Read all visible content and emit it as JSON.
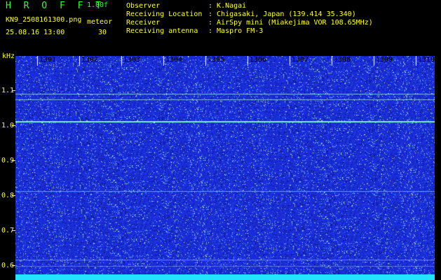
{
  "header": {
    "title": "H R O F F T",
    "version": "1.00f",
    "filename": "KN9_2508161300.png",
    "meteor_label": "meteor",
    "datetime": "25.08.16 13:00",
    "meteor_count": "30",
    "info": [
      {
        "label": "Observer",
        "value": ": K.Nagai"
      },
      {
        "label": "Receiving Location",
        "value": ": Chigasaki, Japan (139.414 35.340)"
      },
      {
        "label": "Receiver",
        "value": ": AirSpy mini (Miakejima VOR 108.65MHz)"
      },
      {
        "label": "Receiving antenna",
        "value": ": Maspro FM-3"
      }
    ]
  },
  "spectrogram": {
    "y_unit": "kHz",
    "y_ticks": [
      "1.1",
      "1.0",
      "0.9",
      "0.8",
      "0.7",
      "0.6"
    ],
    "x_ticks": [
      "1301",
      "1302",
      "1303",
      "1304",
      "1305",
      "1306",
      "1307",
      "1308",
      "1309",
      "1310"
    ],
    "colors": {
      "background": "#1a2cd8",
      "signal": "#7df2c8",
      "text": "#ffff33",
      "header_text": "#33ff33"
    }
  }
}
